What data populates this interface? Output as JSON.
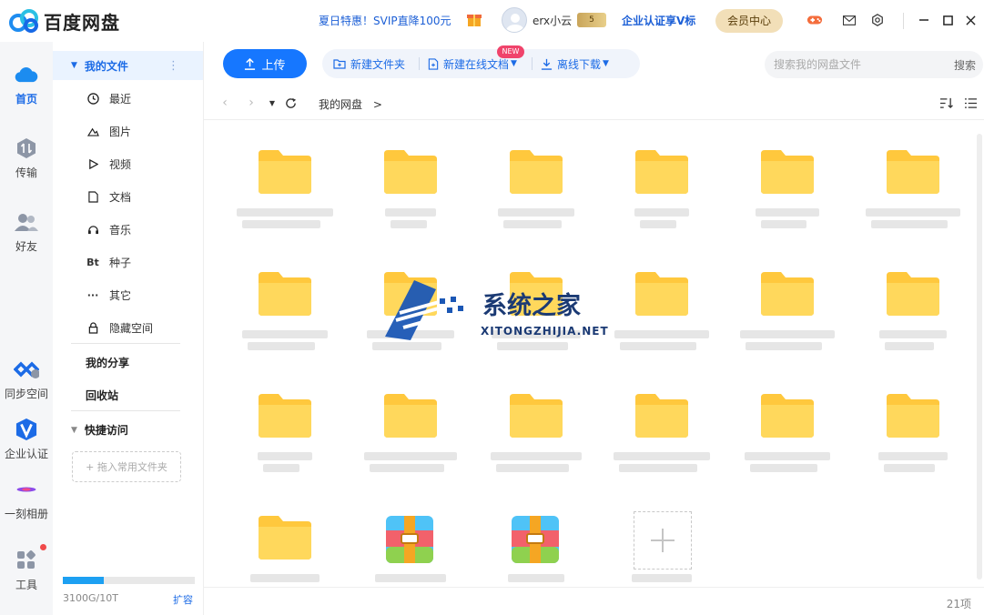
{
  "app": {
    "title": "百度网盘"
  },
  "header": {
    "promo": "夏日特惠！SVIP直降100元",
    "username": "erx小云",
    "vip_level": "5",
    "enterprise": "企业认证享V标",
    "member_center": "会员中心"
  },
  "rail": {
    "home": "首页",
    "transfer": "传输",
    "friends": "好友",
    "sync": "同步空间",
    "enterprise": "企业认证",
    "album": "一刻相册",
    "tools": "工具"
  },
  "sidenav": {
    "my_files": "我的文件",
    "items": [
      {
        "label": "最近",
        "icon": "clock-icon"
      },
      {
        "label": "图片",
        "icon": "image-icon"
      },
      {
        "label": "视频",
        "icon": "play-icon"
      },
      {
        "label": "文档",
        "icon": "document-icon"
      },
      {
        "label": "音乐",
        "icon": "headphones-icon"
      },
      {
        "label": "种子",
        "icon": "bt-icon",
        "glyph": "Bt"
      },
      {
        "label": "其它",
        "icon": "more-icon",
        "glyph": "···"
      },
      {
        "label": "隐藏空间",
        "icon": "lock-icon"
      }
    ],
    "my_share": "我的分享",
    "recycle": "回收站",
    "quick_access": "快捷访问",
    "drop_hint": "+ 拖入常用文件夹",
    "quota": "3100G/10T",
    "quota_used_fraction": 0.31,
    "expand": "扩容"
  },
  "toolbar": {
    "upload": "上传",
    "new_folder": "新建文件夹",
    "new_online_doc": "新建在线文档",
    "new_badge": "NEW",
    "offline_download": "离线下载",
    "search_placeholder": "搜索我的网盘文件",
    "search_button": "搜索"
  },
  "breadcrumb": {
    "path": "我的网盘",
    "separator": ">"
  },
  "watermark": {
    "title": "系统之家",
    "subtitle": "XITONGZHIJIA.NET"
  },
  "status": {
    "item_count": "21项"
  }
}
